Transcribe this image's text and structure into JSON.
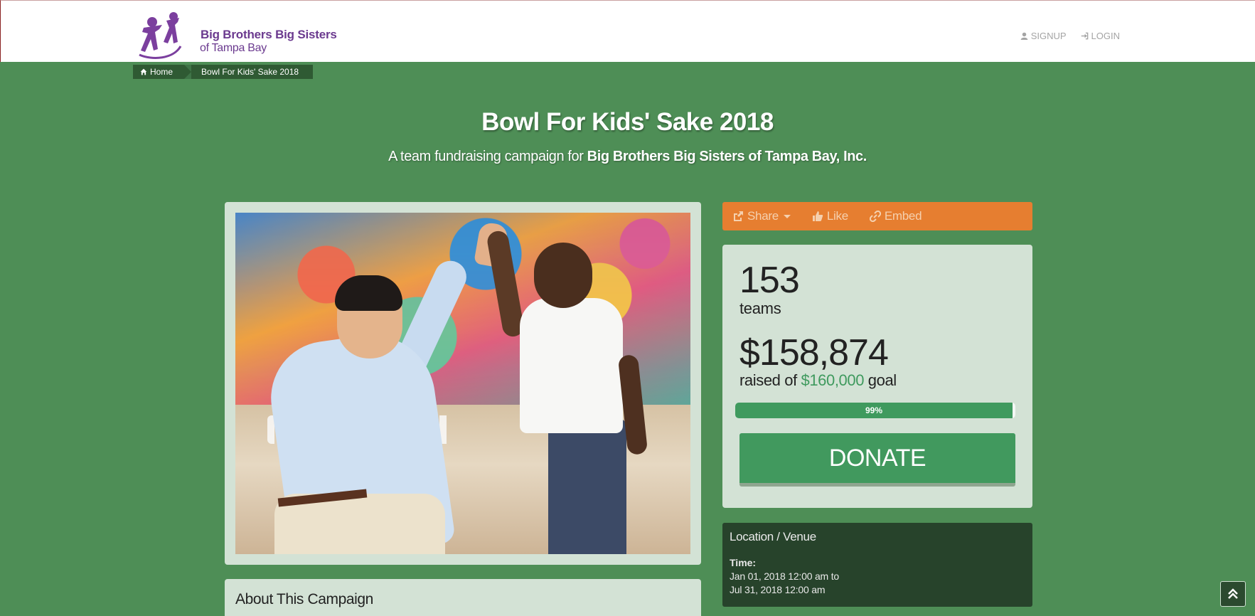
{
  "header": {
    "logo_line1": "Big Brothers Big Sisters",
    "logo_line2": "of Tampa Bay",
    "signup_label": "SIGNUP",
    "login_label": "LOGIN"
  },
  "breadcrumb": {
    "home": "Home",
    "current": "Bowl For Kids' Sake 2018"
  },
  "campaign": {
    "title": "Bowl For Kids' Sake 2018",
    "subtitle_prefix": "A team fundraising campaign for",
    "organization": "Big Brothers Big Sisters of Tampa Bay, Inc."
  },
  "share_bar": {
    "share_label": "Share",
    "like_label": "Like",
    "embed_label": "Embed"
  },
  "stats": {
    "teams_count": "153",
    "teams_label": "teams",
    "raised_amount": "$158,874",
    "raised_prefix": "raised of",
    "goal_amount": "$160,000",
    "goal_suffix": "goal",
    "progress_percent": 99,
    "progress_label": "99%",
    "donate_label": "DONATE"
  },
  "location": {
    "title": "Location / Venue",
    "time_label": "Time:",
    "start": "Jan 01, 2018 12:00 am to",
    "end": "Jul 31, 2018 12:00 am"
  },
  "about": {
    "heading": "About This Campaign"
  },
  "colors": {
    "page_background": "#4e8e56",
    "brand_purple": "#6b3a8f",
    "share_bar": "#e67e30",
    "donate": "#41995e",
    "card": "#d3e2d5"
  },
  "icons": {
    "signup": "user-icon",
    "login": "sign-in-icon",
    "home": "home-icon",
    "share": "share-icon",
    "like": "thumbs-up-icon",
    "embed": "link-icon",
    "scroll_top": "double-chevron-up-icon"
  }
}
